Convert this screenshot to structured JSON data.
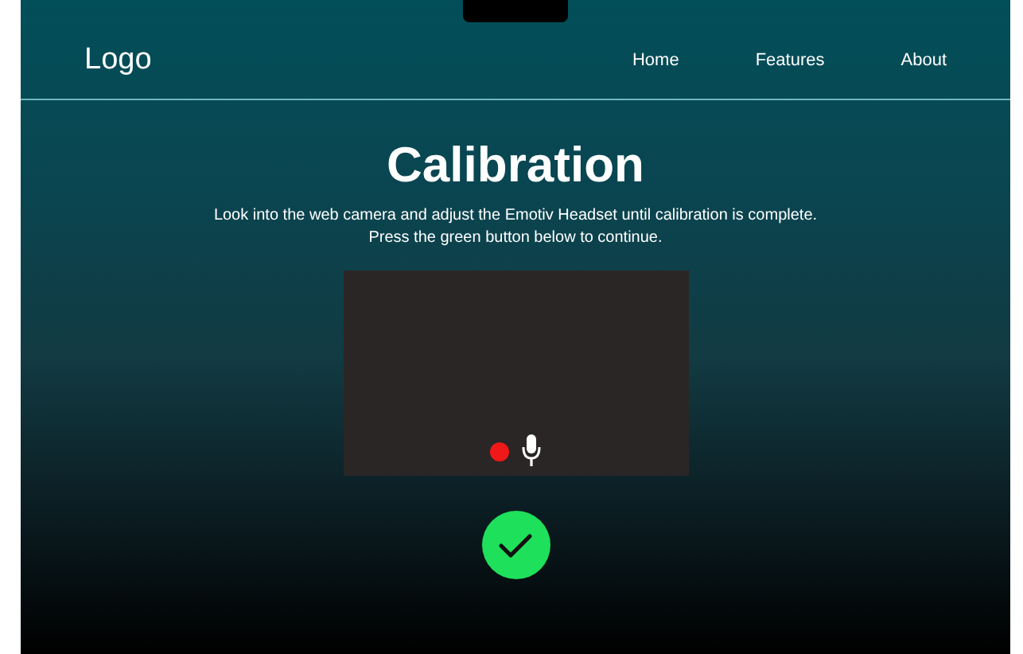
{
  "navbar": {
    "logo": "Logo",
    "links": [
      {
        "label": "Home"
      },
      {
        "label": "Features"
      },
      {
        "label": "About"
      }
    ]
  },
  "title": "Calibration",
  "description_lines": [
    "Look into the web camera and adjust the Emotiv Headset until calibration is complete.",
    "Press the green button below to continue."
  ],
  "camera": {
    "recording": true
  },
  "confirm_button": {
    "color": "#1fe05a"
  }
}
